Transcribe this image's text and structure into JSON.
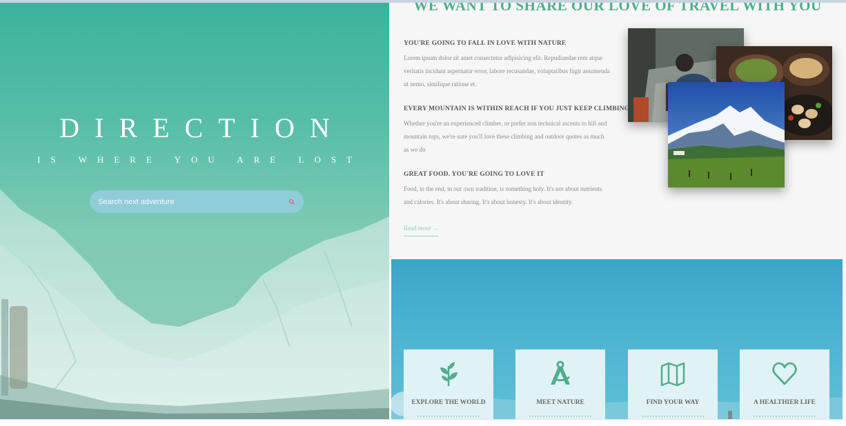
{
  "hero": {
    "title": "DIRECTION",
    "subtitle": "IS WHERE YOU ARE LOST",
    "search": {
      "placeholder": "Search next adventure",
      "icon": "search-icon"
    }
  },
  "info": {
    "heading": "WE WANT TO SHARE OUR LOVE OF TRAVEL WITH YOU",
    "sections": [
      {
        "title": "YOU'RE GOING TO FALL IN LOVE WITH NATURE",
        "text": "Lorem ipsum dolor sit amet consectetur adipisicing elit. Repudiandae rem atque veritatis incidunt aspernatur error, labore recusandae, voluptatibus fugit assumenda ut nemo, similique ratione et."
      },
      {
        "title": "EVERY MOUNTAIN IS WITHIN REACH IF YOU JUST KEEP CLIMBING",
        "text": "Whether you're an experienced climber, or prefer non technical ascents to hill and mountain tops, we're sure you'll love these climbing and outdoor quotes as much as we do"
      },
      {
        "title": "GREAT FOOD. YOU'RE GOING TO LOVE IT",
        "text": "Food, in the end, in our own tradition, is something holy. It's not about nutrients and calories. It's about sharing. It's about honesty. It's about identity."
      }
    ],
    "read_more": "Read more →"
  },
  "features": [
    {
      "label": "EXPLORE THE WORLD",
      "icon": "leaf-icon"
    },
    {
      "label": "MEET NATURE",
      "icon": "compass-icon"
    },
    {
      "label": "FIND YOUR WAY",
      "icon": "map-icon"
    },
    {
      "label": "A HEALTHIER LIFE",
      "icon": "heart-icon"
    }
  ],
  "colors": {
    "accent": "#4fae8c",
    "hero_gradient_top": "#3cb29c",
    "features_bg": "#3aa6c8",
    "card_bg": "#e1f2f6"
  }
}
